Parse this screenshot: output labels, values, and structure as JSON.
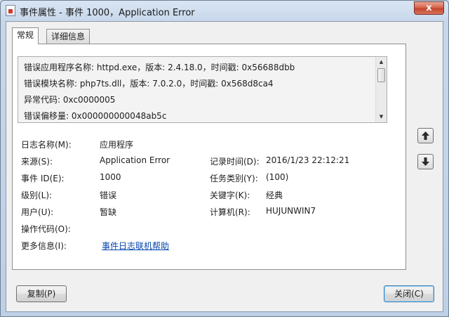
{
  "window": {
    "title": "事件属性 - 事件 1000，Application Error",
    "close_glyph": "x"
  },
  "tabs": [
    {
      "label": "常规",
      "active": true
    },
    {
      "label": "详细信息",
      "active": false
    }
  ],
  "description": {
    "lines": [
      "错误应用程序名称: httpd.exe，版本: 2.4.18.0，时间戳: 0x56688dbb",
      "错误模块名称: php7ts.dll，版本: 7.0.2.0，时间戳: 0x568d8ca4",
      "异常代码: 0xc0000005",
      "错误偏移量: 0x000000000048ab5c"
    ]
  },
  "fields": {
    "log_name": {
      "label": "日志名称(M):",
      "value": "应用程序"
    },
    "source": {
      "label": "来源(S):",
      "value": "Application Error"
    },
    "logged": {
      "label": "记录时间(D):",
      "value": "2016/1/23 22:12:21"
    },
    "event_id": {
      "label": "事件 ID(E):",
      "value": "1000"
    },
    "task_category": {
      "label": "任务类别(Y):",
      "value": "(100)"
    },
    "level": {
      "label": "级别(L):",
      "value": "错误"
    },
    "keywords": {
      "label": "关键字(K):",
      "value": "经典"
    },
    "user": {
      "label": "用户(U):",
      "value": "暂缺"
    },
    "computer": {
      "label": "计算机(R):",
      "value": "HUJUNWIN7"
    },
    "opcode": {
      "label": "操作代码(O):",
      "value": ""
    },
    "more_info": {
      "label": "更多信息(I):",
      "link": "事件日志联机帮助"
    }
  },
  "buttons": {
    "copy": "复制(P)",
    "close": "关闭(C)"
  }
}
